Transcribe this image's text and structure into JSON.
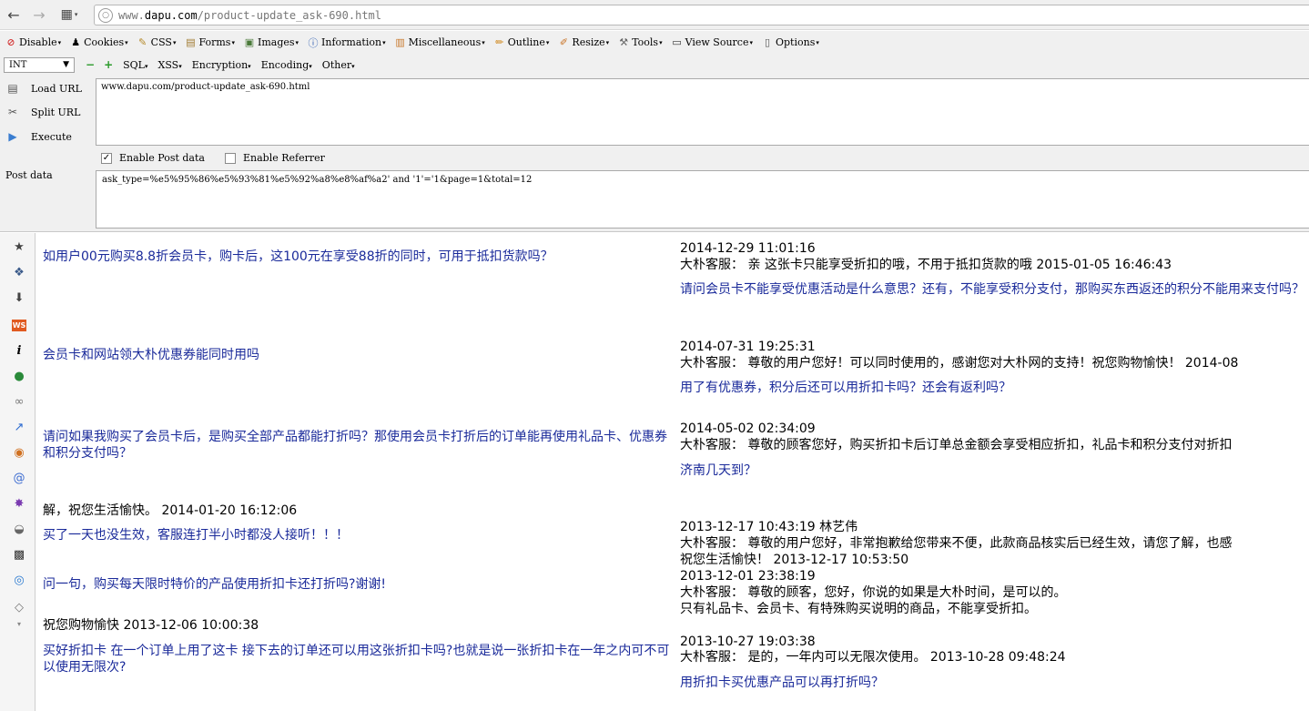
{
  "browser": {
    "url_prefix": "www.",
    "url_host": "dapu.com",
    "url_path": "/product-update_ask-690.html"
  },
  "webdev_toolbar": [
    {
      "label": "Disable",
      "icon": "disable-icon"
    },
    {
      "label": "Cookies",
      "icon": "cookies-icon"
    },
    {
      "label": "CSS",
      "icon": "css-icon"
    },
    {
      "label": "Forms",
      "icon": "forms-icon"
    },
    {
      "label": "Images",
      "icon": "images-icon"
    },
    {
      "label": "Information",
      "icon": "information-icon"
    },
    {
      "label": "Miscellaneous",
      "icon": "miscellaneous-icon"
    },
    {
      "label": "Outline",
      "icon": "outline-icon"
    },
    {
      "label": "Resize",
      "icon": "resize-icon"
    },
    {
      "label": "Tools",
      "icon": "tools-icon"
    },
    {
      "label": "View Source",
      "icon": "view-source-icon"
    },
    {
      "label": "Options",
      "icon": "options-icon"
    }
  ],
  "hackbar": {
    "select_value": "INT",
    "menus": [
      "SQL",
      "XSS",
      "Encryption",
      "Encoding",
      "Other"
    ],
    "load_url": "Load URL",
    "split_url": "Split URL",
    "execute": "Execute",
    "url_value": "www.dapu.com/product-update_ask-690.html",
    "enable_post": "Enable Post data",
    "enable_referrer": "Enable Referrer",
    "post_label": "Post data",
    "post_value": "ask_type=%e5%95%86%e5%93%81%e5%92%a8%e8%af%a2' and '1'='1&page=1&total=12"
  },
  "content": {
    "q1": "如用户00元购买8.8折会员卡，购卡后，这100元在享受88折的同时，可用于抵扣货款吗？",
    "a1_time": "2014-12-29 11:01:16",
    "a1_reply": "大朴客服： 亲 这张卡只能享受折扣的哦，不用于抵扣货款的哦 2015-01-05 16:46:43",
    "q2_right": "请问会员卡不能享受优惠活动是什么意思？还有，不能享受积分支付，那购买东西返还的积分不能用来支付吗？",
    "q3": "会员卡和网站领大朴优惠券能同时用吗",
    "a3_time": "2014-07-31 19:25:31",
    "a3_reply": "大朴客服： 尊敬的用户您好！可以同时使用的，感谢您对大朴网的支持！祝您购物愉快！ 2014-08",
    "q4_right": "用了有优惠券，积分后还可以用折扣卡吗？还会有返利吗？",
    "q5": "请问如果我购买了会员卡后，是购买全部产品都能打折吗？那使用会员卡打折后的订单能再使用礼品卡、优惠券和积分支付吗？",
    "a5_time": "2014-05-02 02:34:09",
    "a5_reply": "大朴客服： 尊敬的顾客您好，购买折扣卡后订单总金额会享受相应折扣，礼品卡和积分支付对折扣",
    "q6_right": "济南几天到？",
    "a6_tail": "解，祝您生活愉快。 2014-01-20 16:12:06",
    "q7": "买了一天也没生效，客服连打半小时都没人接听！！！",
    "a7_time": "2013-12-17 10:43:19 林艺伟",
    "a7_reply": "大朴客服： 尊敬的用户您好，非常抱歉给您带来不便，此款商品核实后已经生效，请您了解，也感",
    "a7_tail": "祝您生活愉快！ 2013-12-17 10:53:50",
    "q8": "问一句，购买每天限时特价的产品使用折扣卡还打折吗?谢谢!",
    "a8_time": "2013-12-01 23:38:19",
    "a8_reply": "大朴客服： 尊敬的顾客，您好，你说的如果是大朴时间，是可以的。",
    "a8_reply2": "只有礼品卡、会员卡、有特殊购买说明的商品，不能享受折扣。",
    "a9_tail": "祝您购物愉快 2013-12-06 10:00:38",
    "q10": "买好折扣卡 在一个订单上用了这卡 接下去的订单还可以用这张折扣卡吗?也就是说一张折扣卡在一年之内可不可以使用无限次?",
    "a10_time": "2013-10-27 19:03:38",
    "a10_reply": "大朴客服： 是的，一年内可以无限次使用。 2013-10-28 09:48:24",
    "q11_right": "用折扣卡买优惠产品可以再打折吗？"
  }
}
